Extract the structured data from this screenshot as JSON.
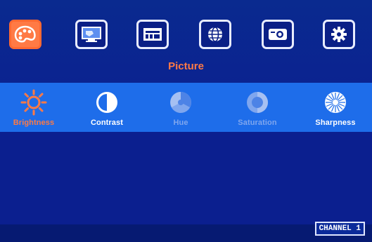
{
  "tabs": [
    {
      "icon": "palette-icon",
      "active": true
    },
    {
      "icon": "display-icon",
      "active": false
    },
    {
      "icon": "input-icon",
      "active": false
    },
    {
      "icon": "globe-icon",
      "active": false
    },
    {
      "icon": "projector-icon",
      "active": false
    },
    {
      "icon": "gear-icon",
      "active": false
    }
  ],
  "category": {
    "title": "Picture"
  },
  "items": [
    {
      "label": "Brightness",
      "state": "selected",
      "icon": "sun-icon"
    },
    {
      "label": "Contrast",
      "state": "normal",
      "icon": "contrast-icon"
    },
    {
      "label": "Hue",
      "state": "disabled",
      "icon": "hue-icon"
    },
    {
      "label": "Saturation",
      "state": "disabled",
      "icon": "saturation-icon"
    },
    {
      "label": "Sharpness",
      "state": "normal",
      "icon": "sharpness-icon"
    }
  ],
  "status": {
    "channel": "CHANNEL 1"
  },
  "colors": {
    "accent": "#ff7a45",
    "band": "#1e6dea",
    "background": "#0a1f8c"
  }
}
